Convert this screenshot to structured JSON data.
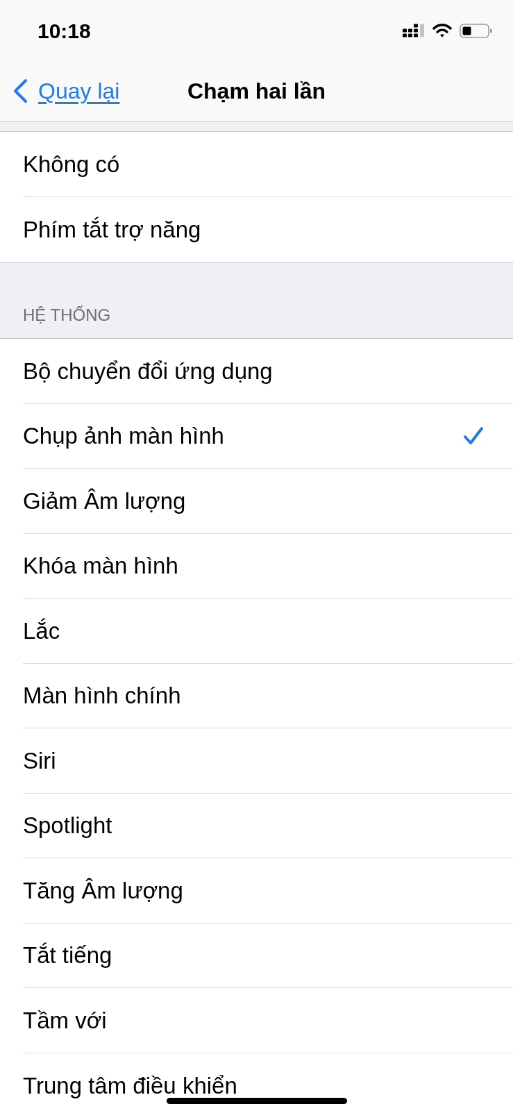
{
  "status_bar": {
    "time": "10:18"
  },
  "nav_bar": {
    "back": "Quay lại",
    "title": "Chạm hai lần"
  },
  "sections": [
    {
      "items": [
        {
          "label": "Không có",
          "selected": false
        },
        {
          "label": "Phím tắt trợ năng",
          "selected": false
        }
      ]
    },
    {
      "header": "HỆ THỐNG",
      "items": [
        {
          "label": "Bộ chuyển đổi ứng dụng",
          "selected": false
        },
        {
          "label": "Chụp ảnh màn hình",
          "selected": true
        },
        {
          "label": "Giảm Âm lượng",
          "selected": false
        },
        {
          "label": "Khóa màn hình",
          "selected": false
        },
        {
          "label": "Lắc",
          "selected": false
        },
        {
          "label": "Màn hình chính",
          "selected": false
        },
        {
          "label": "Siri",
          "selected": false
        },
        {
          "label": "Spotlight",
          "selected": false
        },
        {
          "label": "Tăng Âm lượng",
          "selected": false
        },
        {
          "label": "Tắt tiếng",
          "selected": false
        },
        {
          "label": "Tầm với",
          "selected": false
        },
        {
          "label": "Trung tâm điều khiển",
          "selected": false
        }
      ]
    }
  ]
}
